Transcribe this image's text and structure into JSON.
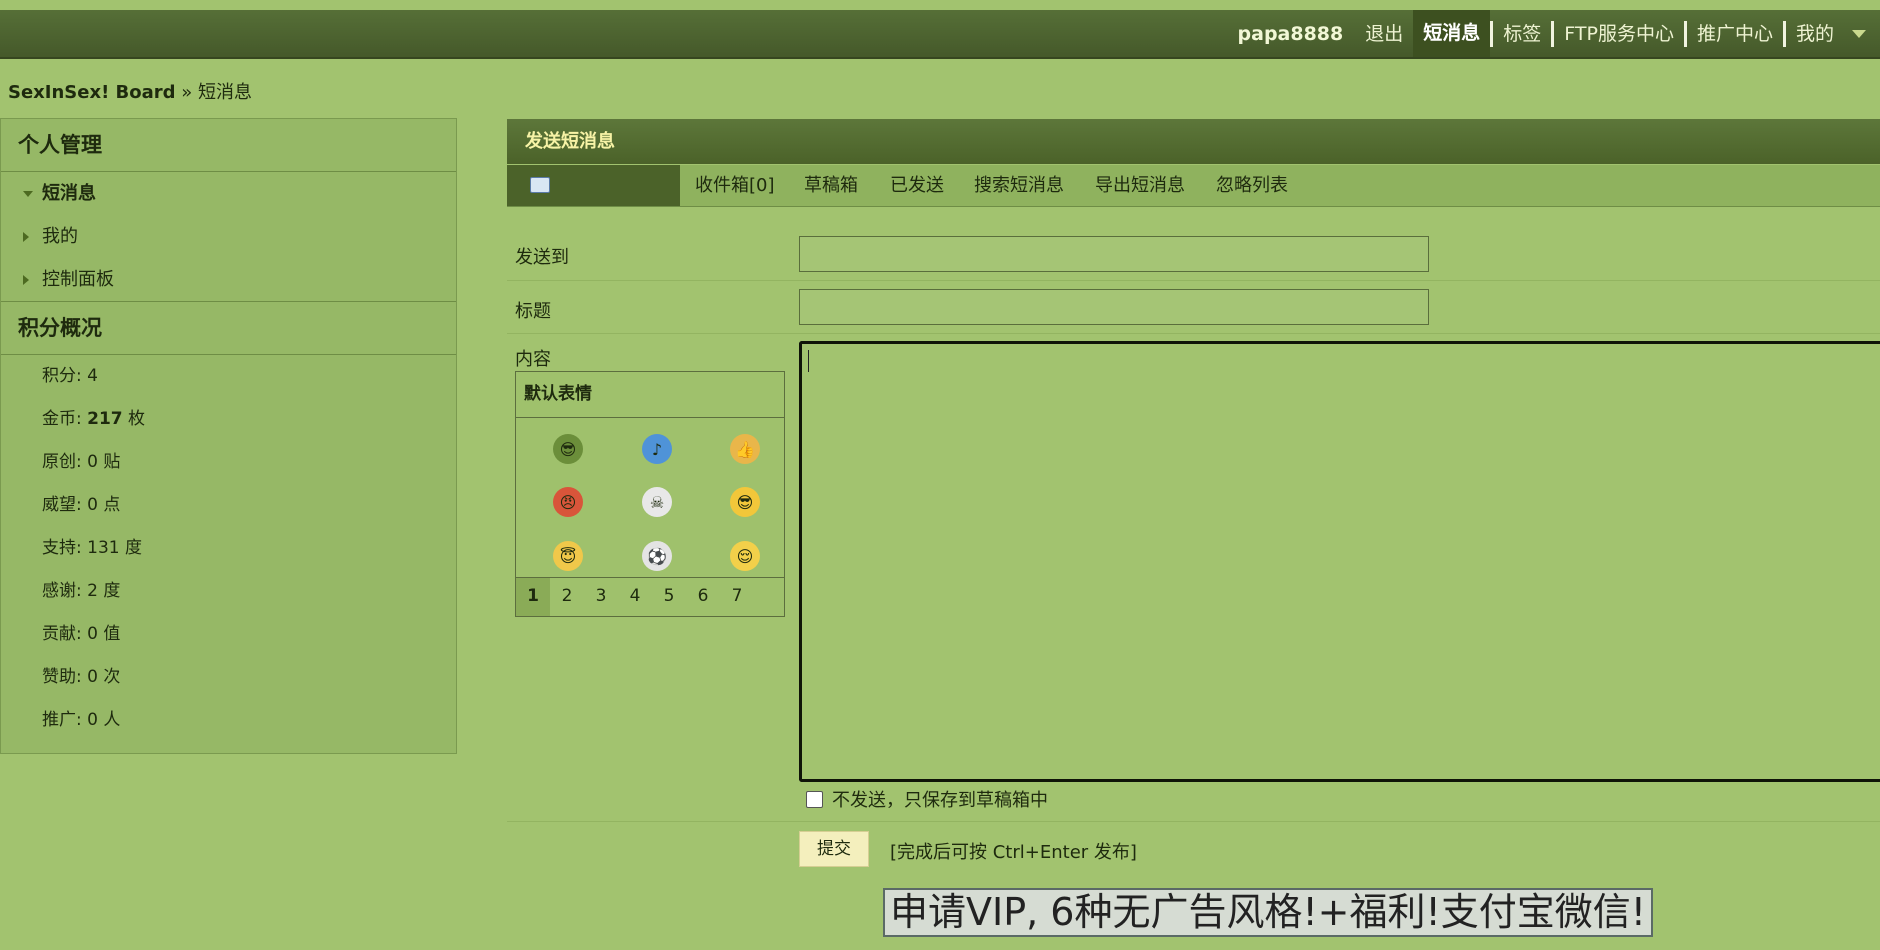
{
  "topnav": {
    "username": "papa8888",
    "items": [
      "退出",
      "短消息",
      "标签",
      "FTP服务中心",
      "推广中心",
      "我的"
    ],
    "active": "短消息"
  },
  "breadcrumb": {
    "board": "SexInSex! Board",
    "separator": " » ",
    "current": "短消息"
  },
  "sidebar": {
    "section1_title": "个人管理",
    "items": [
      "短消息",
      "我的",
      "控制面板"
    ],
    "section2_title": "积分概况",
    "credits": [
      {
        "label": "积分: ",
        "value": "4",
        "unit": ""
      },
      {
        "label": "金币: ",
        "value": "217",
        "unit": " 枚"
      },
      {
        "label": "原创: ",
        "value": "0",
        "unit": " 贴"
      },
      {
        "label": "威望: ",
        "value": "0",
        "unit": " 点"
      },
      {
        "label": "支持: ",
        "value": "131",
        "unit": " 度"
      },
      {
        "label": "感谢: ",
        "value": "2",
        "unit": " 度"
      },
      {
        "label": "贡献: ",
        "value": "0",
        "unit": " 值"
      },
      {
        "label": "赞助: ",
        "value": "0",
        "unit": " 次"
      },
      {
        "label": "推广: ",
        "value": "0",
        "unit": " 人"
      }
    ]
  },
  "panel": {
    "title": "发送短消息",
    "tabs": [
      "收件箱[0]",
      "草稿箱",
      "已发送",
      "搜索短消息",
      "导出短消息",
      "忽略列表"
    ]
  },
  "form": {
    "to_label": "发送到",
    "to_value": "",
    "subject_label": "标题",
    "subject_value": "",
    "content_label": "内容",
    "smilies_title": "默认表情",
    "smilies": [
      {
        "icon": "soldier-smiley-icon",
        "glyph": "😎",
        "bg": "#6b8e3a"
      },
      {
        "icon": "music-note-icon",
        "glyph": "♪",
        "bg": "#4f93d8"
      },
      {
        "icon": "thumbs-up-icon",
        "glyph": "👍",
        "bg": "#e9b64a"
      },
      {
        "icon": "angry-smiley-icon",
        "glyph": "😠",
        "bg": "#d8553a"
      },
      {
        "icon": "skull-icon",
        "glyph": "☠",
        "bg": "#e8e8e8"
      },
      {
        "icon": "cool-smiley-icon",
        "glyph": "😎",
        "bg": "#f2c73a"
      },
      {
        "icon": "angel-smiley-icon",
        "glyph": "😇",
        "bg": "#f0c84a"
      },
      {
        "icon": "soccer-ball-icon",
        "glyph": "⚽",
        "bg": "#e4e4e4"
      },
      {
        "icon": "sleepy-smiley-icon",
        "glyph": "😌",
        "bg": "#f2d04a"
      }
    ],
    "pages": [
      "1",
      "2",
      "3",
      "4",
      "5",
      "6",
      "7"
    ],
    "current_page": "1",
    "save_draft_label": "不发送，只保存到草稿箱中",
    "submit_label": "提交",
    "hint": "[完成后可按 Ctrl+Enter 发布]"
  },
  "banner": {
    "text": "申请VIP, 6种无广告风格!+福利!支付宝微信!"
  }
}
